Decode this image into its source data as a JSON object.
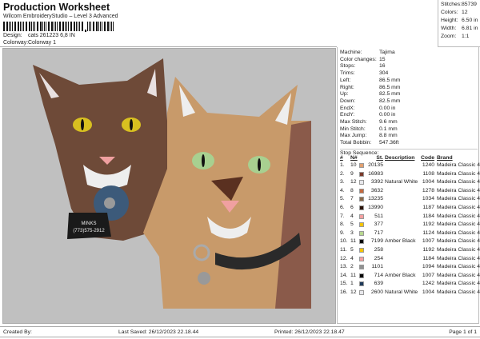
{
  "header": {
    "title": "Production Worksheet",
    "subtitle": "Wilcom EmbroideryStudio – Level 3 Advanced",
    "barcode_text": "barcode",
    "design_label": "Design:",
    "design_value": "cats 261223 6,8 IN",
    "colorway_label": "Colorway:",
    "colorway_value": "Colorway 1"
  },
  "stats": [
    {
      "label": "Stitches:",
      "value": "85739"
    },
    {
      "label": "Colors:",
      "value": "12"
    },
    {
      "label": "Height:",
      "value": "6.50 in"
    },
    {
      "label": "Width:",
      "value": "6.81 in"
    },
    {
      "label": "Zoom:",
      "value": "1:1"
    }
  ],
  "info": [
    {
      "label": "Machine:",
      "value": "Tajima"
    },
    {
      "label": "Color changes:",
      "value": "15"
    },
    {
      "label": "Stops:",
      "value": "16"
    },
    {
      "label": "Trims:",
      "value": "304"
    },
    {
      "label": "Left:",
      "value": "86.5 mm"
    },
    {
      "label": "Right:",
      "value": "86.5 mm"
    },
    {
      "label": "Up:",
      "value": "82.5 mm"
    },
    {
      "label": "Down:",
      "value": "82.5 mm"
    },
    {
      "label": "EndX:",
      "value": "0.00 in"
    },
    {
      "label": "EndY:",
      "value": "0.00 in"
    },
    {
      "label": "Max Stitch:",
      "value": "9.6 mm"
    },
    {
      "label": "Min Stitch:",
      "value": "0.1 mm"
    },
    {
      "label": "Max Jump:",
      "value": "8.8 mm"
    },
    {
      "label": "Total Bobbin:",
      "value": "547.36ft"
    }
  ],
  "stop_sequence": {
    "title": "Stop Sequence:",
    "columns": [
      "#",
      "N#",
      "St.",
      "Description",
      "Code",
      "Brand"
    ],
    "rows": [
      {
        "i": "1.",
        "n": "10",
        "color": "#e0a070",
        "st": "20135",
        "desc": "",
        "code": "1240",
        "brand": "Madeira Classic 40"
      },
      {
        "i": "2.",
        "n": "9",
        "color": "#7a3a2a",
        "st": "16983",
        "desc": "",
        "code": "1108",
        "brand": "Madeira Classic 40"
      },
      {
        "i": "3.",
        "n": "12",
        "color": "#e8e8ec",
        "st": "3392",
        "desc": "Natural White",
        "code": "1004",
        "brand": "Madeira Classic 40"
      },
      {
        "i": "4.",
        "n": "8",
        "color": "#c46a40",
        "st": "3632",
        "desc": "",
        "code": "1278",
        "brand": "Madeira Classic 40"
      },
      {
        "i": "5.",
        "n": "7",
        "color": "#8a6a4a",
        "st": "13235",
        "desc": "",
        "code": "1034",
        "brand": "Madeira Classic 40"
      },
      {
        "i": "6.",
        "n": "6",
        "color": "#2a1208",
        "st": "13990",
        "desc": "",
        "code": "1187",
        "brand": "Madeira Classic 40"
      },
      {
        "i": "7.",
        "n": "4",
        "color": "#f4a0a0",
        "st": "511",
        "desc": "",
        "code": "1184",
        "brand": "Madeira Classic 40"
      },
      {
        "i": "8.",
        "n": "5",
        "color": "#f4c400",
        "st": "377",
        "desc": "",
        "code": "1192",
        "brand": "Madeira Classic 40"
      },
      {
        "i": "9.",
        "n": "3",
        "color": "#b8d890",
        "st": "717",
        "desc": "",
        "code": "1124",
        "brand": "Madeira Classic 40"
      },
      {
        "i": "10.",
        "n": "11",
        "color": "#080808",
        "st": "7199",
        "desc": "Amber Black",
        "code": "1007",
        "brand": "Madeira Classic 40"
      },
      {
        "i": "11.",
        "n": "5",
        "color": "#f4c400",
        "st": "258",
        "desc": "",
        "code": "1192",
        "brand": "Madeira Classic 40"
      },
      {
        "i": "12.",
        "n": "4",
        "color": "#f4a0a0",
        "st": "254",
        "desc": "",
        "code": "1184",
        "brand": "Madeira Classic 40"
      },
      {
        "i": "13.",
        "n": "2",
        "color": "#909090",
        "st": "1101",
        "desc": "",
        "code": "1094",
        "brand": "Madeira Classic 40"
      },
      {
        "i": "14.",
        "n": "11",
        "color": "#080808",
        "st": "714",
        "desc": "Amber Black",
        "code": "1007",
        "brand": "Madeira Classic 40"
      },
      {
        "i": "15.",
        "n": "1",
        "color": "#1e3a5a",
        "st": "639",
        "desc": "",
        "code": "1242",
        "brand": "Madeira Classic 40"
      },
      {
        "i": "16.",
        "n": "12",
        "color": "#e8e8ec",
        "st": "2600",
        "desc": "Natural White",
        "code": "1004",
        "brand": "Madeira Classic 40"
      }
    ]
  },
  "design_preview": {
    "tag_name": "MINKS",
    "tag_phone": "(773)575-2912"
  },
  "footer": {
    "created_by": "Created By:",
    "last_saved": "Last Saved: 26/12/2023 22.18.44",
    "printed": "Printed: 26/12/2023 22.18.47",
    "page": "Page 1 of 1"
  }
}
